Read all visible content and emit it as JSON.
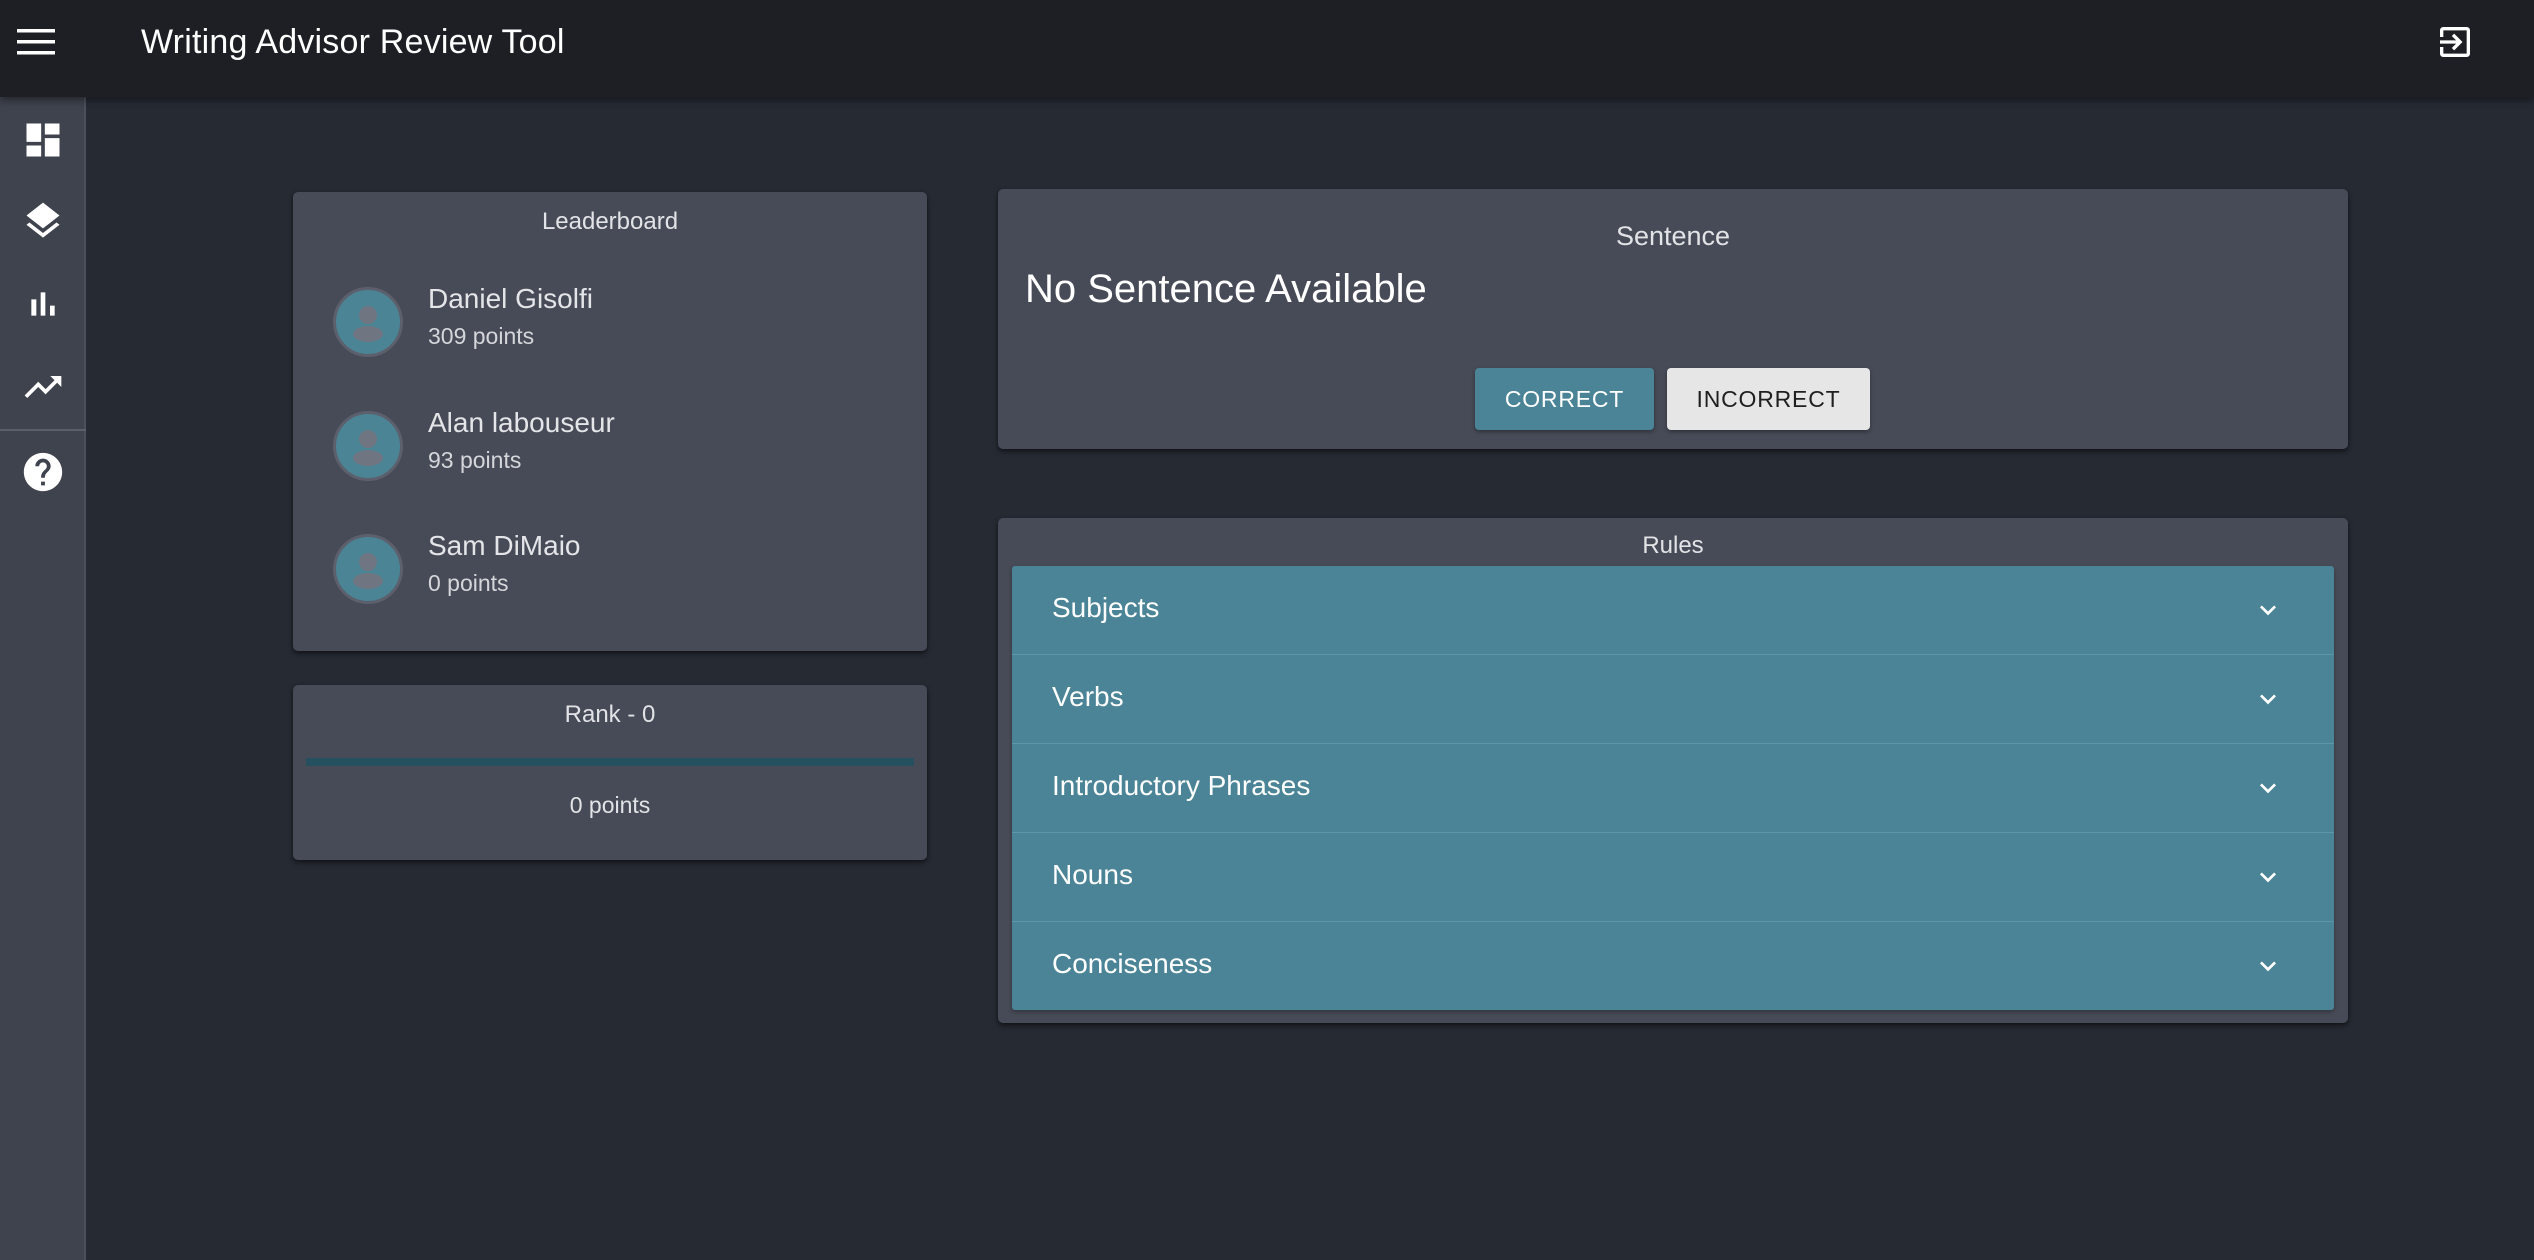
{
  "app": {
    "title": "Writing Advisor Review Tool",
    "menu_icon": "menu-icon",
    "logout_icon": "logout-icon"
  },
  "sidebar": {
    "items": [
      {
        "icon": "dashboard-icon"
      },
      {
        "icon": "layers-icon"
      },
      {
        "icon": "bar-chart-icon"
      },
      {
        "icon": "trending-up-icon"
      },
      {
        "icon": "help-icon"
      }
    ]
  },
  "leaderboard": {
    "title": "Leaderboard",
    "entries": [
      {
        "name": "Daniel Gisolfi",
        "points": "309 points"
      },
      {
        "name": "Alan labouseur",
        "points": "93 points"
      },
      {
        "name": "Sam DiMaio",
        "points": "0 points"
      }
    ]
  },
  "rank": {
    "title": "Rank - 0",
    "progress_fraction": 0,
    "points": "0 points"
  },
  "sentence": {
    "title": "Sentence",
    "text": "No Sentence Available",
    "correct_label": "CORRECT",
    "incorrect_label": "INCORRECT"
  },
  "rules": {
    "title": "Rules",
    "items": [
      {
        "label": "Subjects"
      },
      {
        "label": "Verbs"
      },
      {
        "label": "Introductory Phrases"
      },
      {
        "label": "Nouns"
      },
      {
        "label": "Conciseness"
      }
    ]
  },
  "colors": {
    "accent": "#4a8496",
    "appbar": "#1d1f24",
    "background": "#262a33",
    "card": "#474b57",
    "sidebar": "#3f434e"
  }
}
